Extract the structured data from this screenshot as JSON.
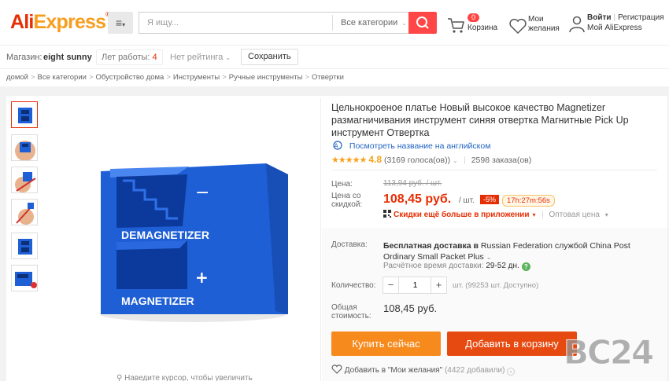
{
  "header": {
    "logo": {
      "ali": "Ali",
      "express": "Express"
    },
    "menu_icon": "hamburger-icon",
    "search": {
      "placeholder": "Я ищу...",
      "category": "Все категории"
    },
    "cart": {
      "count": "0",
      "label": "Корзина"
    },
    "wishlist": {
      "line1": "Мои",
      "line2": "желания"
    },
    "account": {
      "login": "Войти",
      "register": "Регистрация",
      "my": "Мой AliExpress"
    }
  },
  "store": {
    "label": "Магазин:",
    "name": "eight sunny",
    "years_prefix": "Лет работы:",
    "years_value": "4",
    "rating": "Нет рейтинга",
    "save_button": "Сохранить"
  },
  "breadcrumb": [
    "домой",
    "Все категории",
    "Обустройство дома",
    "Инструменты",
    "Ручные инструменты",
    "Отвертки"
  ],
  "product": {
    "title": "Цельнокроеное платье Новый высокое качество Magnetizer размагничивания инструмент синяя отвертка Магнитные Pick Up инструмент Отвертка",
    "translate_link": "Посмотреть название на английском",
    "rating": {
      "stars": "★★★★★",
      "score": "4.8",
      "votes": "(3169 голоса(ов))",
      "orders": "2598 заказа(ов)"
    },
    "price": {
      "label": "Цена:",
      "old": "113,94 руб. / шт.",
      "sale_label_1": "Цена со",
      "sale_label_2": "скидкой:",
      "new": "108,45 руб.",
      "unit": "/ шт.",
      "discount": "-5%",
      "timer": "17h:27m:56s"
    },
    "app_discount": "Скидки ещё больше в приложении",
    "wholesale": "Оптовая цена",
    "shipping": {
      "label": "Доставка:",
      "free": "Бесплатная доставка в",
      "text": "Russian Federation службой China Post Ordinary Small Packet Plus",
      "time_label": "Расчётное время доставки:",
      "time": "29-52 дн."
    },
    "quantity": {
      "label": "Количество:",
      "value": "1",
      "available": "шт. (99253 шт. Доступно)"
    },
    "total": {
      "label_1": "Общая",
      "label_2": "стоимость:",
      "value": "108,45 руб."
    },
    "buy_now": "Купить сейчас",
    "add_to_cart": "Добавить в корзину",
    "wishlist_add": "Добавить в \"Мои желания\"",
    "wishlist_count": "(4422 добавили)",
    "image": {
      "top_text": "DEMAGNETIZER",
      "bottom_text": "MAGNETIZER",
      "minus": "−",
      "plus": "+"
    },
    "zoom_hint": "Наведите курсор, чтобы увеличить"
  },
  "watermark": "BC24",
  "colors": {
    "brand": "#e62e04",
    "buy": "#f78a1d",
    "cart": "#e74a10",
    "product_blue": "#1e5fd6"
  }
}
